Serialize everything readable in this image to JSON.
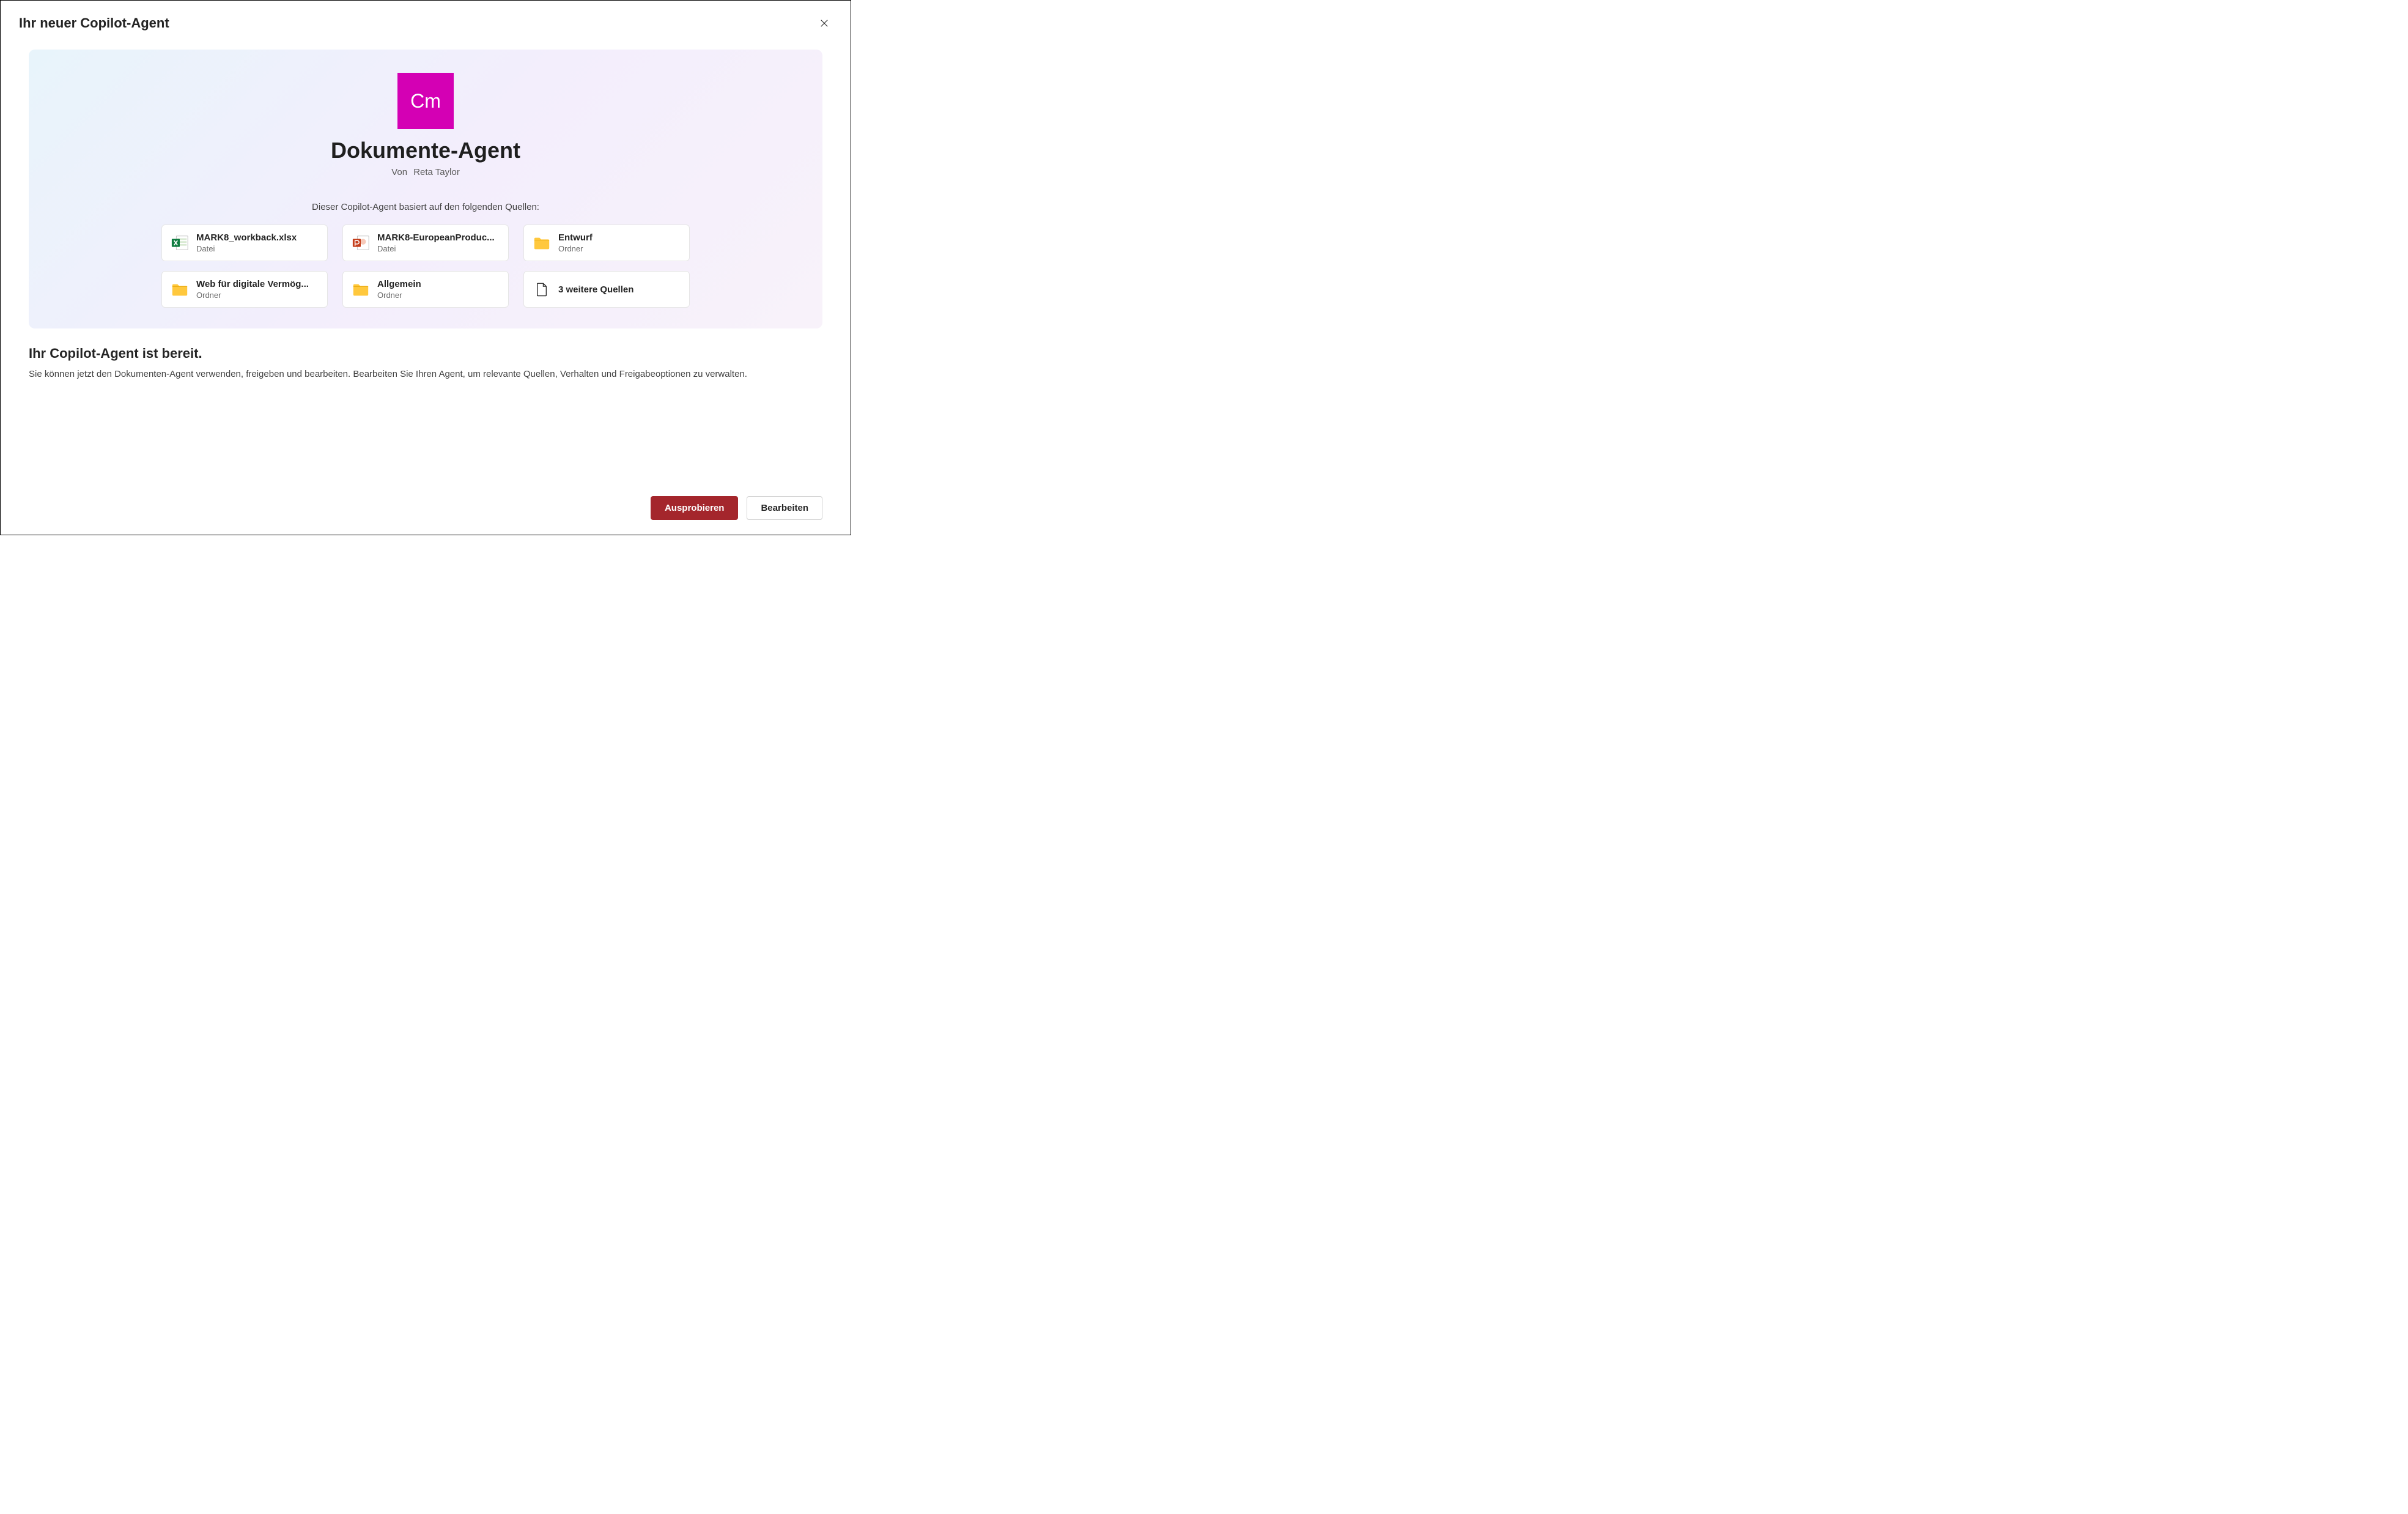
{
  "header": {
    "title": "Ihr neuer Copilot-Agent"
  },
  "agent": {
    "badge_text": "Cm",
    "badge_color": "#d400b4",
    "name": "Dokumente-Agent",
    "author_prefix": "Von",
    "author_name": "Reta Taylor"
  },
  "sources": {
    "intro": "Dieser Copilot-Agent basiert auf den folgenden Quellen:",
    "items": [
      {
        "icon": "excel-icon",
        "name": "MARK8_workback.xlsx",
        "type": "Datei"
      },
      {
        "icon": "powerpoint-icon",
        "name": "MARK8-EuropeanProduc...",
        "type": "Datei"
      },
      {
        "icon": "folder-icon",
        "name": "Entwurf",
        "type": "Ordner"
      },
      {
        "icon": "folder-icon",
        "name": "Web für digitale Vermög...",
        "type": "Ordner"
      },
      {
        "icon": "folder-icon",
        "name": "Allgemein",
        "type": "Ordner"
      },
      {
        "icon": "document-icon",
        "name": "3 weitere Quellen",
        "type": ""
      }
    ]
  },
  "ready": {
    "heading": "Ihr Copilot-Agent ist bereit.",
    "description": "Sie können jetzt den Dokumenten-Agent verwenden, freigeben und bearbeiten. Bearbeiten Sie Ihren Agent, um relevante Quellen, Verhalten und Freigabeoptionen zu verwalten."
  },
  "footer": {
    "primary_label": "Ausprobieren",
    "secondary_label": "Bearbeiten"
  }
}
